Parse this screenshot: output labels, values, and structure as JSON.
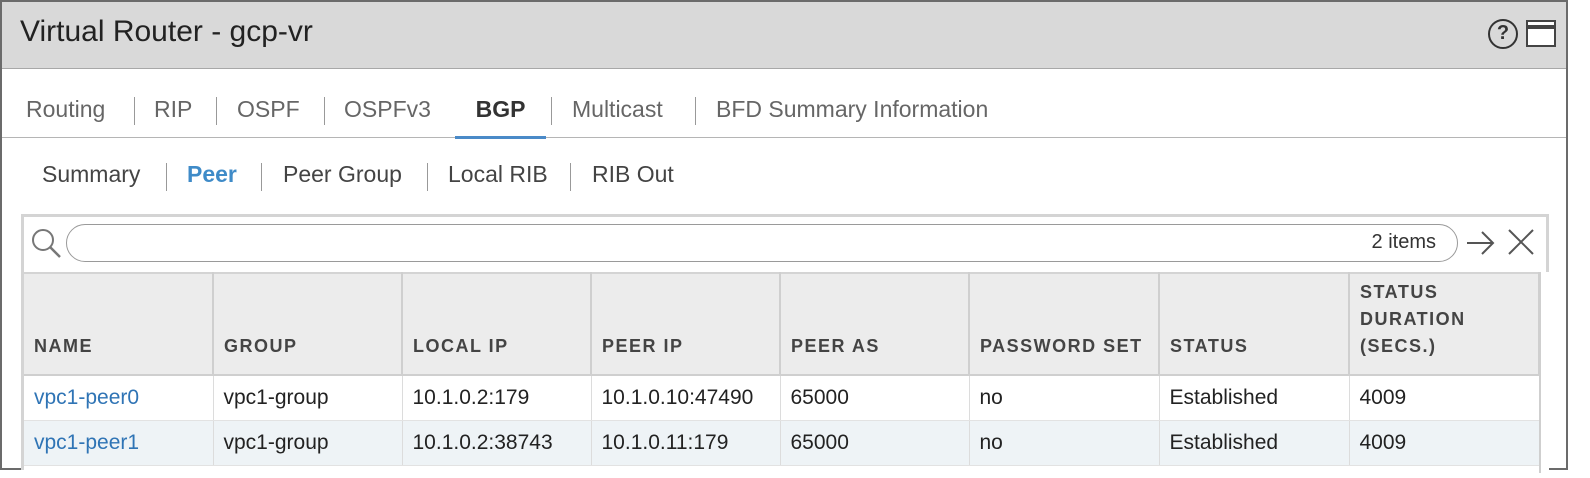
{
  "window": {
    "title": "Virtual Router - gcp-vr"
  },
  "tabs": [
    {
      "label": "Routing"
    },
    {
      "label": "RIP"
    },
    {
      "label": "OSPF"
    },
    {
      "label": "OSPFv3"
    },
    {
      "label": "BGP",
      "active": true
    },
    {
      "label": "Multicast"
    },
    {
      "label": "BFD Summary Information"
    }
  ],
  "subtabs": [
    {
      "label": "Summary"
    },
    {
      "label": "Peer",
      "active": true
    },
    {
      "label": "Peer Group"
    },
    {
      "label": "Local RIB"
    },
    {
      "label": "RIB Out"
    }
  ],
  "search": {
    "value": "",
    "count_label": "2 items"
  },
  "table": {
    "headers": [
      "NAME",
      "GROUP",
      "LOCAL IP",
      "PEER IP",
      "PEER AS",
      "PASSWORD SET",
      "STATUS",
      "STATUS DURATION (SECS.)"
    ],
    "rows": [
      [
        "vpc1-peer0",
        "vpc1-group",
        "10.1.0.2:179",
        "10.1.0.10:47490",
        "65000",
        "no",
        "Established",
        "4009"
      ],
      [
        "vpc1-peer1",
        "vpc1-group",
        "10.1.0.2:38743",
        "10.1.0.11:179",
        "65000",
        "no",
        "Established",
        "4009"
      ]
    ]
  },
  "colors": {
    "accent": "#3f8bc8",
    "link": "#2f74b5",
    "titlebar": "#d9d9d9"
  }
}
